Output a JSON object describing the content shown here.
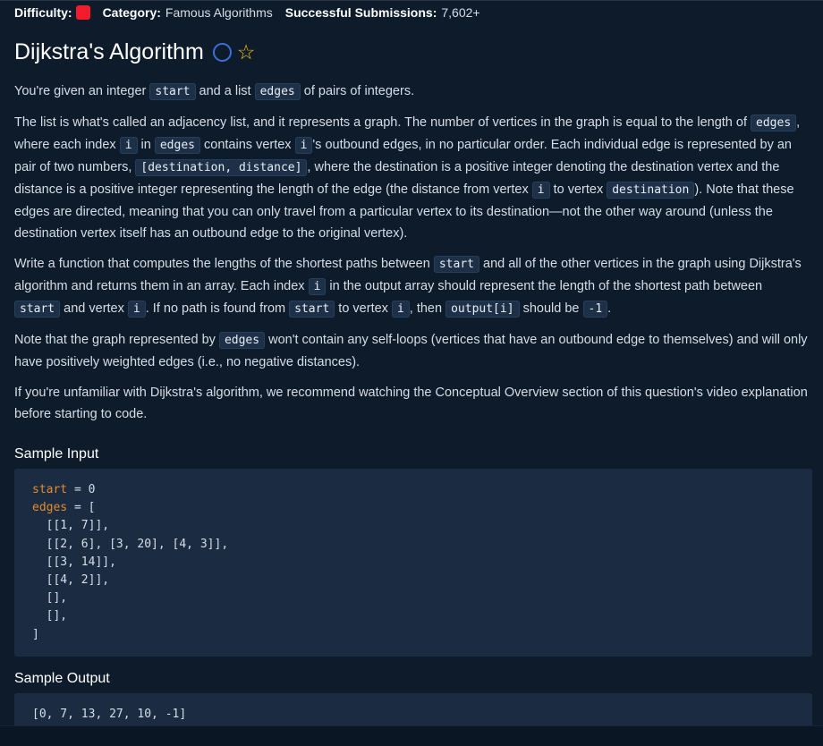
{
  "meta": {
    "difficulty_label": "Difficulty:",
    "category_label": "Category:",
    "category_value": "Famous Algorithms",
    "submissions_label": "Successful Submissions:",
    "submissions_value": "7,602+",
    "difficulty_color": "#f21c2c"
  },
  "title": "Dijkstra's Algorithm",
  "icons": {
    "status": "circle-icon",
    "favorite": "star-icon"
  },
  "sections": {
    "sample_input": "Sample Input",
    "sample_output": "Sample Output"
  },
  "p1": [
    "You're given an integer ",
    "start",
    " and a list ",
    "edges",
    " of pairs of integers."
  ],
  "p2": [
    "The list is what's called an adjacency list, and it represents a graph. The number of vertices in the graph is equal to the length of ",
    "edges",
    ", where each index ",
    "i",
    " in ",
    "edges",
    " contains vertex ",
    "i",
    "'s outbound edges, in no particular order. Each individual edge is represented by an pair of two numbers, ",
    "[destination, distance]",
    ", where the destination is a positive integer denoting the destination vertex and the distance is a positive integer representing the length of the edge (the distance from vertex ",
    "i",
    " to vertex ",
    "destination",
    "). Note that these edges are directed, meaning that you can only travel from a particular vertex to its destination—not the other way around (unless the destination vertex itself has an outbound edge to the original vertex)."
  ],
  "p3": [
    "Write a function that computes the lengths of the shortest paths between ",
    "start",
    " and all of the other vertices in the graph using Dijkstra's algorithm and returns them in an array. Each index ",
    "i",
    " in the output array should represent the length of the shortest path between ",
    "start",
    " and vertex ",
    "i",
    ". If no path is found from ",
    "start",
    " to vertex ",
    "i",
    ", then ",
    "output[i]",
    " should be ",
    "-1",
    "."
  ],
  "p4": [
    "Note that the graph represented by ",
    "edges",
    " won't contain any self-loops (vertices that have an outbound edge to themselves) and will only have positively weighted edges (i.e., no negative distances)."
  ],
  "p5": [
    "If you're unfamiliar with Dijkstra's algorithm, we recommend watching the Conceptual Overview section of this question's video explanation before starting to code."
  ],
  "sample_input": {
    "start_var": "start",
    "start_rest": " = 0",
    "edges_var": "edges",
    "edges_rest": " = [",
    "lines": [
      "  [[1, 7]],",
      "  [[2, 6], [3, 20], [4, 3]],",
      "  [[3, 14]],",
      "  [[4, 2]],",
      "  [],",
      "  [],",
      "]"
    ]
  },
  "sample_output": "[0, 7, 13, 27, 10, -1]"
}
